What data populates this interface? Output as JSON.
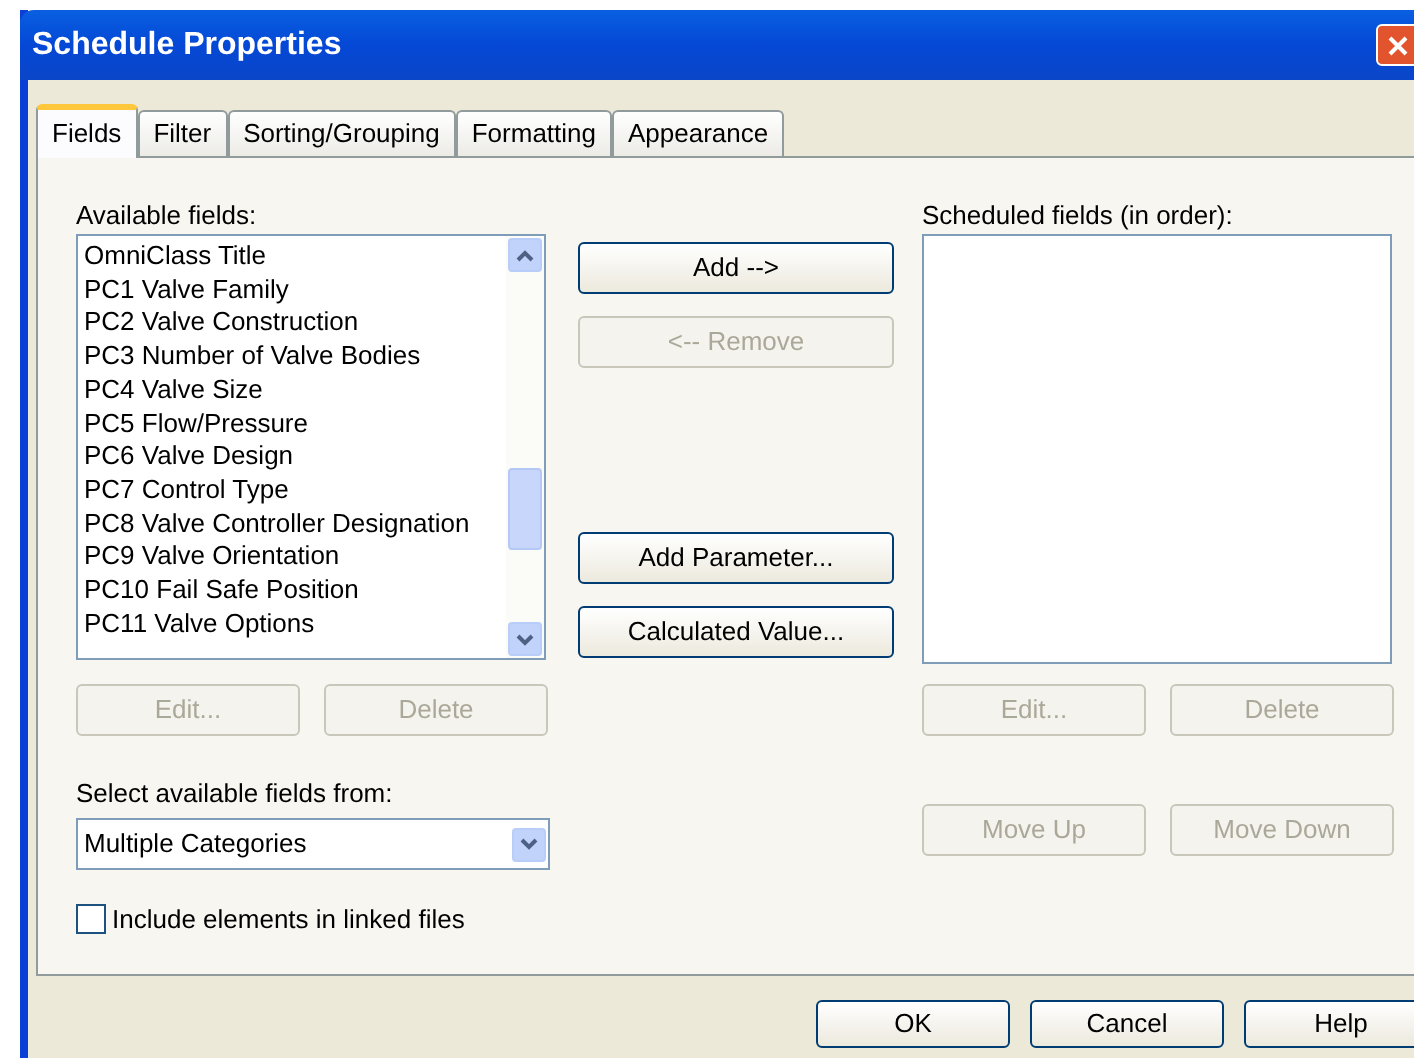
{
  "window": {
    "title": "Schedule Properties"
  },
  "tabs": [
    {
      "label": "Fields",
      "selected": true
    },
    {
      "label": "Filter",
      "selected": false
    },
    {
      "label": "Sorting/Grouping",
      "selected": false
    },
    {
      "label": "Formatting",
      "selected": false
    },
    {
      "label": "Appearance",
      "selected": false
    }
  ],
  "available": {
    "label": "Available fields:",
    "items": [
      "OmniClass Title",
      "PC1 Valve Family",
      "PC2 Valve Construction",
      "PC3 Number of Valve Bodies",
      "PC4 Valve Size",
      "PC5 Flow/Pressure",
      "PC6 Valve Design",
      "PC7 Control Type",
      "PC8 Valve Controller Designation",
      "PC9 Valve Orientation",
      "PC10 Fail Safe Position",
      "PC11 Valve Options"
    ],
    "buttons": [
      {
        "label": "Edit...",
        "disabled": true
      },
      {
        "label": "Delete",
        "disabled": true
      }
    ]
  },
  "middle_buttons": [
    {
      "label": "Add -->",
      "disabled": false
    },
    {
      "label": "<-- Remove",
      "disabled": true
    },
    {
      "label": "Add Parameter...",
      "disabled": false
    },
    {
      "label": "Calculated Value...",
      "disabled": false
    }
  ],
  "scheduled": {
    "label": "Scheduled fields (in order):",
    "buttons": [
      {
        "label": "Edit...",
        "disabled": true
      },
      {
        "label": "Delete",
        "disabled": true
      }
    ],
    "move_buttons": [
      {
        "label": "Move Up",
        "disabled": true
      },
      {
        "label": "Move Down",
        "disabled": true
      }
    ]
  },
  "source": {
    "label": "Select available fields from:",
    "value": "Multiple Categories"
  },
  "linked": {
    "label": "Include elements in linked files",
    "checked": false
  },
  "footer_buttons": [
    {
      "label": "OK",
      "disabled": false
    },
    {
      "label": "Cancel",
      "disabled": false
    },
    {
      "label": "Help",
      "disabled": false
    }
  ]
}
